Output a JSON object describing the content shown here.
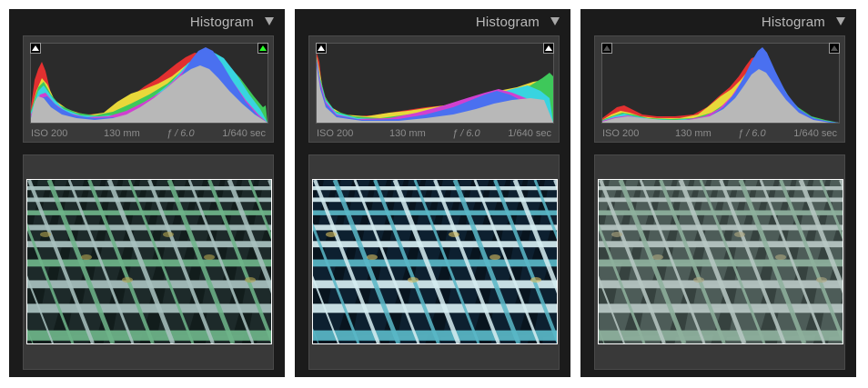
{
  "panels": [
    {
      "title": "Histogram",
      "info": {
        "iso": "ISO 200",
        "focal": "130 mm",
        "aperture": "ƒ / 6.0",
        "shutter": "1/640 sec"
      },
      "clip_left": {
        "state": "on",
        "color": "#ffffff"
      },
      "clip_right": {
        "state": "on",
        "color": "#2aff2a"
      },
      "photo_variant": "standard",
      "colors": {
        "frame": "#d8d8d8",
        "grid_dark": "#1d2a2a",
        "green": "#6fb58a",
        "steel": "#a9c2c0",
        "shadow": "#121d1c",
        "accent": "#b4a550"
      }
    },
    {
      "title": "Histogram",
      "info": {
        "iso": "ISO 200",
        "focal": "130 mm",
        "aperture": "ƒ / 6.0",
        "shutter": "1/640 sec"
      },
      "clip_left": {
        "state": "on",
        "color": "#ffffff"
      },
      "clip_right": {
        "state": "on",
        "color": "#ffffff"
      },
      "photo_variant": "overexposed-contrast",
      "colors": {
        "frame": "#e8f0f4",
        "grid_dark": "#0d2030",
        "green": "#5ab8c8",
        "steel": "#d6eef2",
        "shadow": "#08141e",
        "accent": "#d8c060"
      }
    },
    {
      "title": "Histogram",
      "info": {
        "iso": "ISO 200",
        "focal": "130 mm",
        "aperture": "ƒ / 6.0",
        "shutter": "1/640 sec"
      },
      "clip_left": {
        "state": "off",
        "color": "#555555"
      },
      "clip_right": {
        "state": "off",
        "color": "#555555"
      },
      "photo_variant": "flat-low-contrast",
      "colors": {
        "frame": "#c8d0cc",
        "grid_dark": "#4d5c58",
        "green": "#8fb29e",
        "steel": "#b8c8c4",
        "shadow": "#36423f",
        "accent": "#b0a880"
      }
    }
  ]
}
